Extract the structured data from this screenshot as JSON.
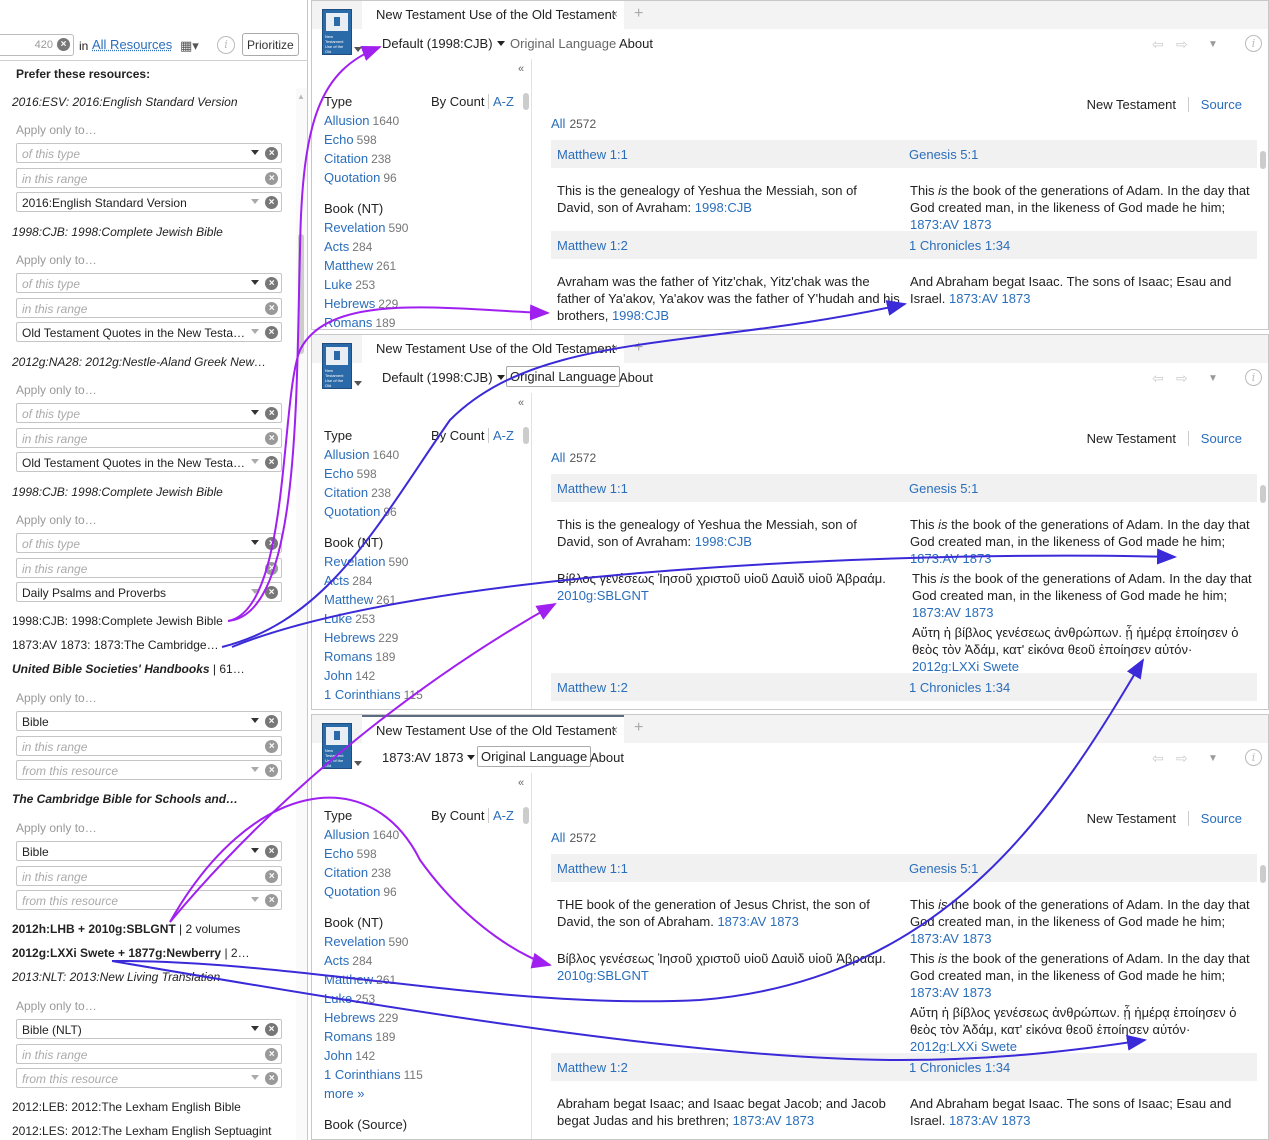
{
  "left": {
    "count": "420",
    "in_label": "in",
    "all_resources": "All Resources",
    "prioritize": "Prioritize",
    "prefer_title": "Prefer these resources:",
    "apply_only": "Apply only to…",
    "ph_type": "of this type",
    "ph_range": "in this range",
    "ph_resource": "from this resource",
    "r1": "2016:ESV: 2016:English Standard Version",
    "r1_f3": "2016:English Standard Version",
    "r2": "1998:CJB: 1998:Complete Jewish Bible",
    "r2_f3": "Old Testament Quotes in the New Testa…",
    "r3": "2012g:NA28: 2012g:Nestle-Aland Greek New…",
    "r3_f3": "Old Testament Quotes in the New Testa…",
    "r4": "1998:CJB: 1998:Complete Jewish Bible",
    "r4_f3": "Daily Psalms and Proverbs",
    "r5": "1998:CJB: 1998:Complete Jewish Bible",
    "r6": "1873:AV 1873: 1873:The Cambridge…",
    "r7": "United Bible Societies' Handbooks",
    "r7_suffix": " | 61…",
    "r7_f1": "Bible",
    "r8": "The Cambridge Bible for Schools and…",
    "r8_f1": "Bible",
    "r9": "2012h:LHB + 2010g:SBLGNT",
    "r9_suffix": " | 2 volumes",
    "r10": "2012g:LXXi Swete + 1877g:Newberry",
    "r10_suffix": " | 2…",
    "r11": "2013:NLT: 2013:New Living Translation",
    "r11_f1": "Bible (NLT)",
    "r12": "2012:LEB: 2012:The Lexham English Bible",
    "r13": "2012:LES: 2012:The Lexham English Septuagint"
  },
  "common": {
    "tab_title": "New Testament Use of the Old Testament",
    "orig_lang": "Original Language",
    "about": "About",
    "type": "Type",
    "by_count": "By Count",
    "az": "A-Z",
    "book_nt": "Book (NT)",
    "book_source": "Book (Source)",
    "more": "more »",
    "new_testament": "New Testament",
    "source": "Source",
    "all": "All",
    "all_count": "2572",
    "allusion": "Allusion",
    "allusion_n": "1640",
    "echo": "Echo",
    "echo_n": "598",
    "citation": "Citation",
    "citation_n": "238",
    "quotation": "Quotation",
    "quotation_n": "96",
    "revelation": "Revelation",
    "revelation_n": "590",
    "acts": "Acts",
    "acts_n": "284",
    "matthew": "Matthew",
    "matthew_n": "261",
    "luke": "Luke",
    "luke_n": "253",
    "hebrews": "Hebrews",
    "hebrews_n": "229",
    "romans": "Romans",
    "romans_n": "189",
    "john": "John",
    "john_n": "142",
    "cor": "1 Corinthians",
    "cor_n": "115",
    "mt11": "Matthew 1:1",
    "gen51": "Genesis 5:1",
    "mt12": "Matthew 1:2",
    "chr134": "1 Chronicles 1:34",
    "cjb_mt11": "This is the genealogy of Yeshua the Messiah, son of David, son of Avraham:",
    "cjb_ref": "1998:CJB",
    "av_gen51_a": "This ",
    "av_gen51_is": "is",
    "av_gen51_b": " the book of the generations of Adam. In the day that God created man, in the likeness of God made he him;",
    "av_ref": "1873:AV 1873",
    "cjb_mt12": "Avraham was the father of Yitz'chak, Yitz'chak was the father of Ya'akov, Ya'akov was the father of Y'hudah and his brothers,",
    "av_chr134": "And Abraham begat Isaac. The sons of Isaac; Esau and Israel.",
    "gk_mt11": "Βίβλος γενέσεως Ἰησοῦ χριστοῦ υἱοῦ Δαυὶδ υἱοῦ Ἀβραάμ.",
    "gk_ref": "2010g:SBLGNT",
    "lxx_gen51": "Αὕτη ἡ βίβλος γενέσεως ἀνθρώπων. ᾗ ἡμέρᾳ ἐποίησεν ὁ θεὸς τὸν Ἀδάμ, κατ' εἰκόνα θεοῦ ἐποίησεν αὐτόν·",
    "lxx_ref": "2012g:LXXi Swete",
    "av_mt11_a": "THE",
    "av_mt11_b": " book of the generation of Jesus Christ, the son of David, the son of Abraham.",
    "av_mt12": "Abraham begat Isaac; and Isaac begat Jacob; and Jacob begat Judas and his brethren;"
  },
  "win1": {
    "version": "Default (1998:CJB)"
  },
  "win2": {
    "version": "Default (1998:CJB)"
  },
  "win3": {
    "version": "1873:AV 1873"
  },
  "colors": {
    "link": "#2a6ebb",
    "arrow_purple": "#a020f0",
    "arrow_blue": "#3a2ad8"
  }
}
